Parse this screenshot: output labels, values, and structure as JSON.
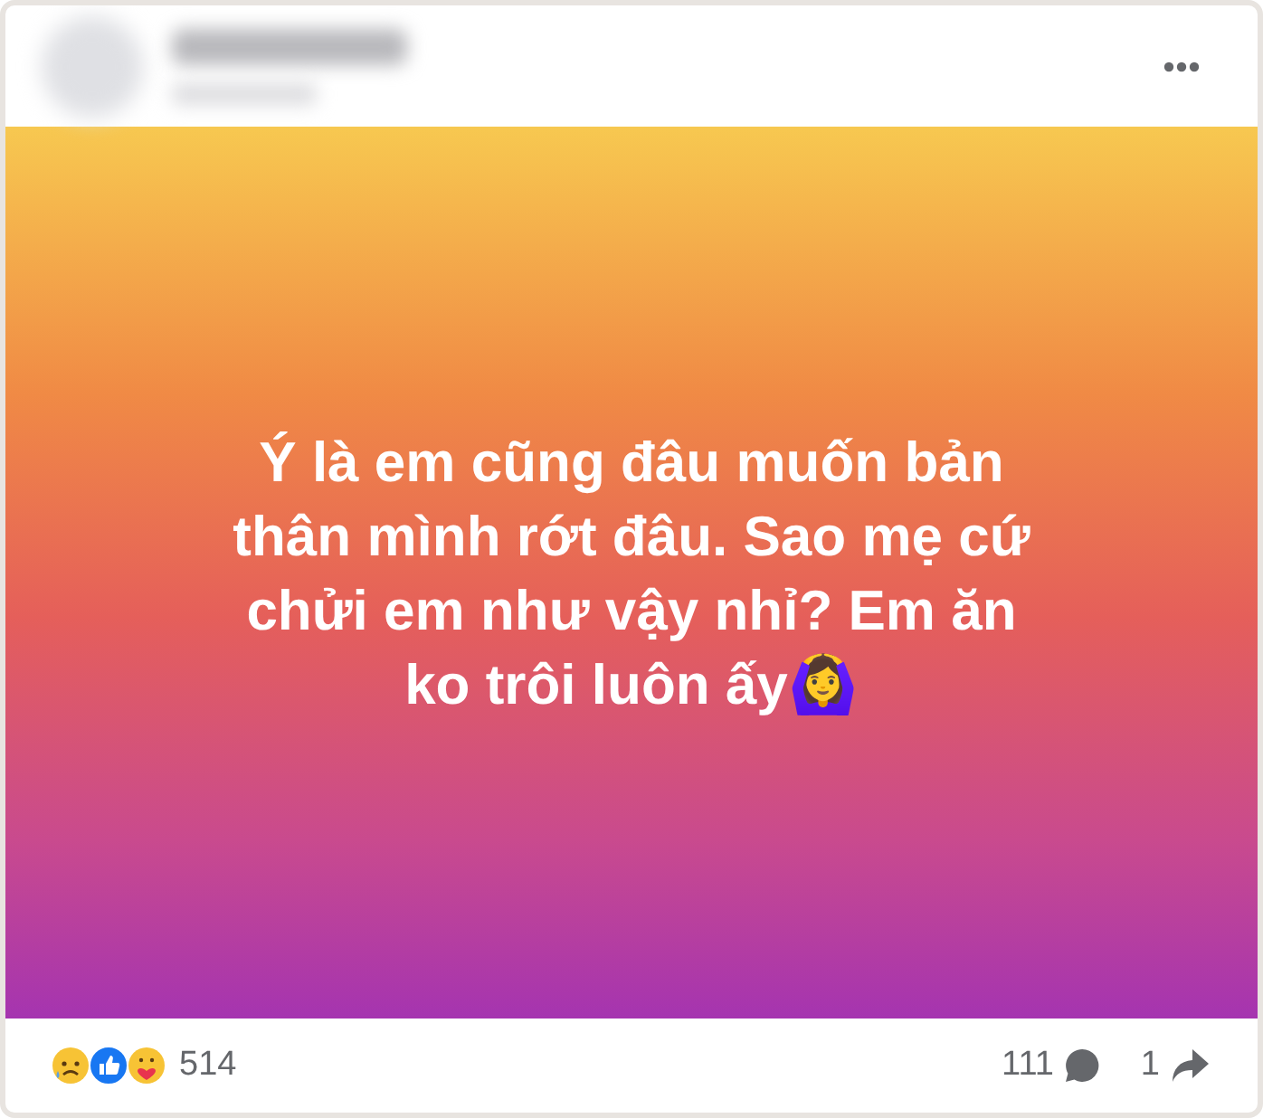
{
  "post": {
    "text": "Ý là em cũng đâu muốn bản thân mình rớt đâu. Sao mẹ cứ chửi em như vậy nhỉ? Em ăn ko trôi luôn ấy🙆‍♀️"
  },
  "footer": {
    "reaction_count": "514",
    "comment_count": "111",
    "share_count": "1"
  }
}
